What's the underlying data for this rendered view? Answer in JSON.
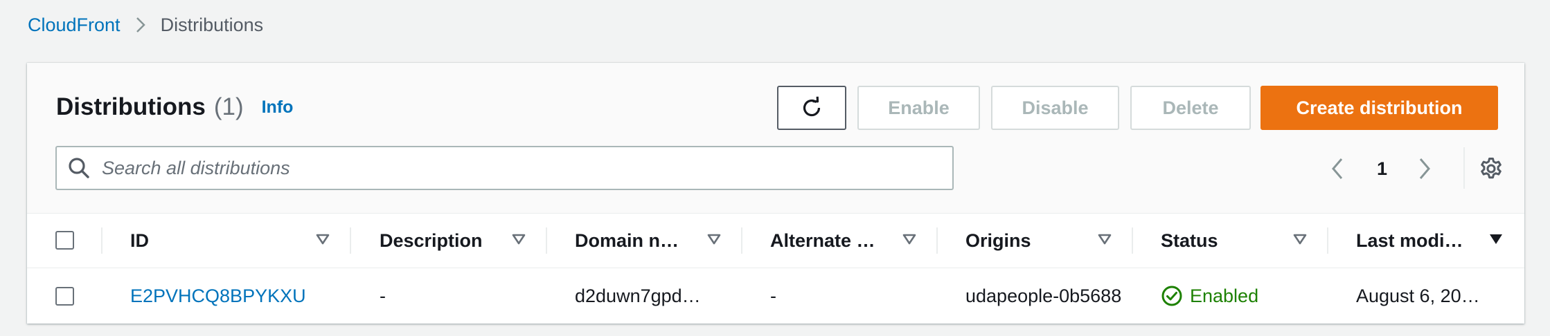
{
  "breadcrumb": {
    "service": "CloudFront",
    "current": "Distributions"
  },
  "header": {
    "title": "Distributions",
    "count": "(1)",
    "info": "Info"
  },
  "toolbar": {
    "enable_label": "Enable",
    "disable_label": "Disable",
    "delete_label": "Delete",
    "create_label": "Create distribution"
  },
  "search": {
    "placeholder": "Search all distributions",
    "value": ""
  },
  "pagination": {
    "current_page": "1"
  },
  "table": {
    "columns": [
      "ID",
      "Description",
      "Domain n…",
      "Alternate …",
      "Origins",
      "Status",
      "Last modi…"
    ],
    "rows": [
      {
        "id": "E2PVHCQ8BPYKXU",
        "description": "-",
        "domain": "d2duwn7gpd…",
        "alternate": "-",
        "origins": "udapeople-0b5688",
        "status": "Enabled",
        "last_modified": "August 6, 20…"
      }
    ]
  },
  "colors": {
    "link": "#0073bb",
    "primary": "#ec7211",
    "success": "#1d8102",
    "disabled_text": "#aab7b8",
    "background": "#f2f3f3"
  }
}
